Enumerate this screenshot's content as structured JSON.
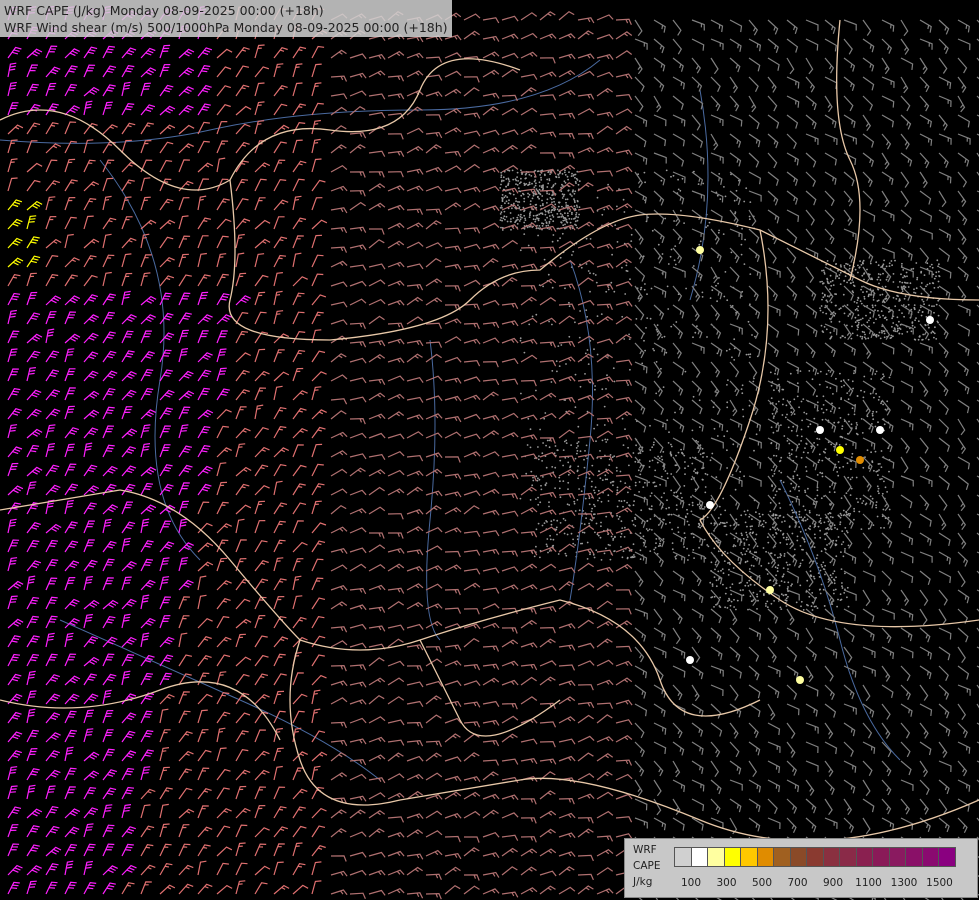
{
  "titles": {
    "line1": "WRF CAPE (J/kg) Monday 08-09-2025 00:00 (+18h)",
    "line2": "WRF Wind shear (m/s) 500/1000hPa Monday 08-09-2025 00:00 (+18h)"
  },
  "legend": {
    "label_lines": [
      "WRF",
      "CAPE",
      "J/kg"
    ],
    "colors": [
      "#d0d0d0",
      "#ffffff",
      "#ffffa0",
      "#ffff00",
      "#ffc800",
      "#e08c00",
      "#a06020",
      "#8a4a28",
      "#8a3a30",
      "#8a3040",
      "#8a2a48",
      "#8a2050",
      "#8a1a58",
      "#8a1a60",
      "#8a1068",
      "#8a0a70",
      "#8a0080"
    ],
    "ticks": [
      "100",
      "300",
      "500",
      "700",
      "900",
      "1100",
      "1300",
      "1500"
    ]
  },
  "colors": {
    "background": "#000000",
    "border": "#e8c8a8",
    "river": "#4a6aa0",
    "barb_low": "#808080",
    "barb_mid": "#b07070",
    "barb_high": "#e07070",
    "barb_strong": "#ff20ff",
    "barb_extreme": "#ffff00",
    "stipple": "#9a9a9a"
  }
}
